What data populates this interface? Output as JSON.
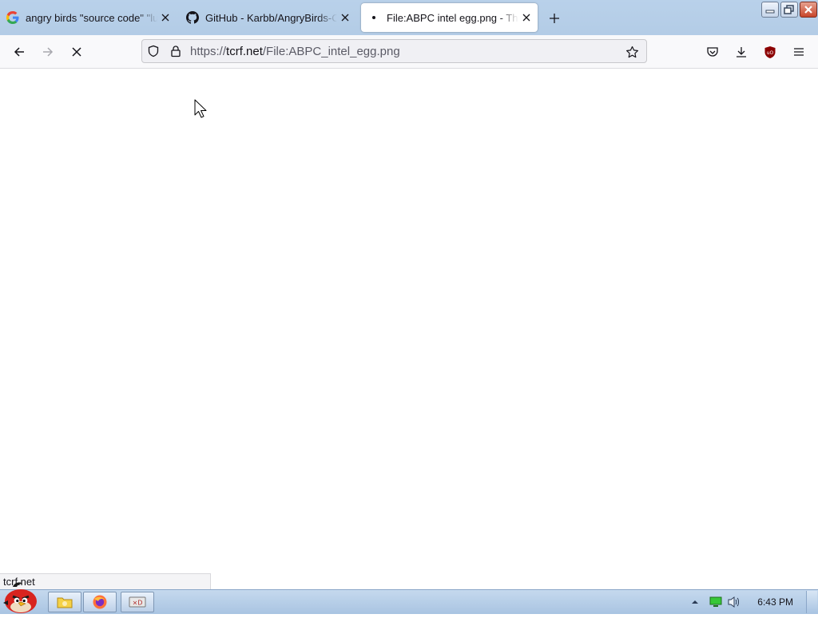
{
  "browser": {
    "tabs": [
      {
        "title": "angry birds \"source code\" \"lu",
        "favicon": "google-g-icon",
        "active": false
      },
      {
        "title": "GitHub - Karbb/AngryBirds-C",
        "favicon": "github-icon",
        "active": false
      },
      {
        "title": "File:ABPC intel egg.png - The",
        "favicon": "loading-dot-icon",
        "active": true
      }
    ],
    "url": {
      "scheme": "https://",
      "host": "tcrf.net",
      "path": "/File:ABPC_intel_egg.png"
    },
    "status_text": "tcrf.net"
  },
  "taskbar": {
    "clock": "6:43 PM"
  },
  "colors": {
    "tabstrip": "#b9d1ea",
    "ublock": "#8b0000"
  }
}
